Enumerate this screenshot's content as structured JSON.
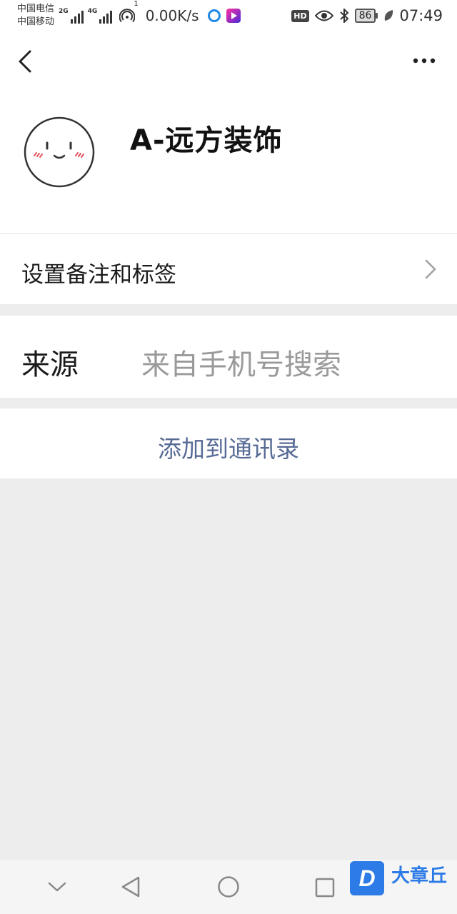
{
  "status_bar": {
    "carrier_1": "中国电信",
    "carrier_2": "中国移动",
    "signal_1_label": "2G",
    "signal_2_label": "4G",
    "hotspot_count": "1",
    "net_speed": "0.00K/s",
    "hd_label": "HD",
    "battery": "86",
    "time": "07:49"
  },
  "nav": {
    "back_icon": "chevron-left-icon",
    "more_icon": "more-icon"
  },
  "profile": {
    "name": "A-远方装饰"
  },
  "remark_row": {
    "label": "设置备注和标签"
  },
  "source_row": {
    "key": "来源",
    "value": "来自手机号搜索"
  },
  "add_button": {
    "label": "添加到通讯录",
    "color": "#576b95"
  },
  "watermark": {
    "logo_letter": "D",
    "text": "大章丘"
  }
}
